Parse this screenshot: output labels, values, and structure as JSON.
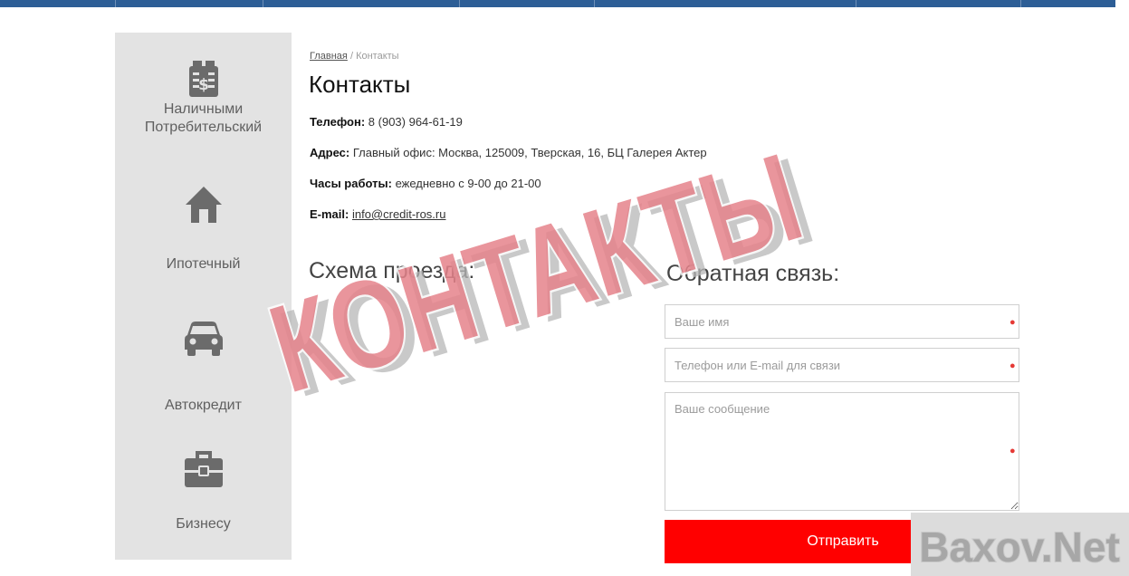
{
  "breadcrumb": {
    "home": "Главная",
    "separator": "/",
    "current": "Контакты"
  },
  "page_title": "Контакты",
  "contacts": {
    "phone_label": "Телефон:",
    "phone_value": "8 (903) 964-61-19",
    "address_label": "Адрес:",
    "address_value": "Главный офис: Москва, 125009, Тверская, 16, БЦ Галерея Актер",
    "hours_label": "Часы работы:",
    "hours_value": "ежедневно с 9-00 до 21-00",
    "email_label": "E-mail:",
    "email_value": "info@credit-ros.ru"
  },
  "sidebar": {
    "items": [
      {
        "label_line1": "Наличными",
        "label_line2": "Потребительский",
        "icon": "cash-register-icon"
      },
      {
        "label": "Ипотечный",
        "icon": "house-icon"
      },
      {
        "label": "Автокредит",
        "icon": "car-icon"
      },
      {
        "label": "Бизнесу",
        "icon": "briefcase-icon"
      }
    ]
  },
  "map_section": {
    "title": "Схема проезда:"
  },
  "feedback": {
    "title": "Обратная связь:",
    "name_placeholder": "Ваше имя",
    "contact_placeholder": "Телефон или E-mail для связи",
    "message_placeholder": "Ваше сообщение",
    "submit_label": "Отправить"
  },
  "watermark": {
    "text": "КОНТАКТЫ"
  },
  "site_logo": {
    "text": "Baxov.Net"
  },
  "colors": {
    "accent": "#ff0000",
    "topbar": "#2d5e96",
    "sidebar_bg": "#e3e3e3",
    "watermark": "#e6838b"
  }
}
